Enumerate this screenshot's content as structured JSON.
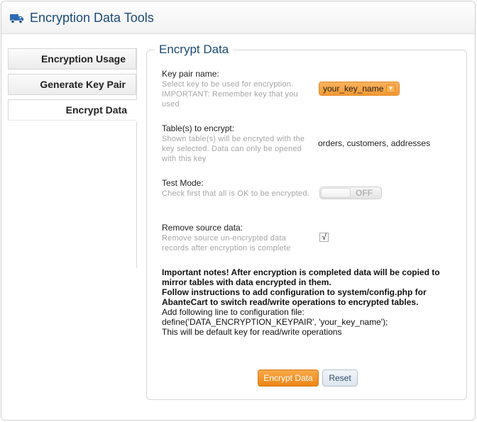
{
  "header": {
    "title": "Encryption Data Tools",
    "icon": "truck-icon"
  },
  "tabs": [
    {
      "label": "Encryption Usage"
    },
    {
      "label": "Generate Key Pair"
    },
    {
      "label": "Encrypt Data"
    }
  ],
  "form": {
    "legend": "Encrypt Data",
    "key_pair": {
      "label": "Key pair name:",
      "help": "Select key to be used for encryption. IMPORTANT: Remember key that you used",
      "value": "your_key_name"
    },
    "tables": {
      "label": "Table(s) to encrypt:",
      "help": "Shown table(s) will be encryted with the key selected. Data can only be opened with this key",
      "value": "orders, customers, addresses"
    },
    "test_mode": {
      "label": "Test Mode:",
      "help": "Check first that all is OK to be encrypted.",
      "state": "OFF"
    },
    "remove_source": {
      "label": "Remove source data:",
      "help": "Remove source un-encrypted data records after encryption is complete",
      "check": "√"
    }
  },
  "notes": {
    "line1": "Important notes! After encryption is completed data will be copied to mirror tables with data encrypted in them.",
    "line2": "Follow instructions to add configuration to system/config.php for AbanteCart to switch read/write operations to encrypted tables.",
    "line3": "Add following line to configuration file:",
    "line4": "define('DATA_ENCRYPTION_KEYPAIR', 'your_key_name');",
    "line5": "This will be default key for read/write operations"
  },
  "buttons": {
    "encrypt": "Encrypt Data",
    "reset": "Reset"
  },
  "colors": {
    "accent": "#1b4a78",
    "orange": "#eb8617"
  }
}
